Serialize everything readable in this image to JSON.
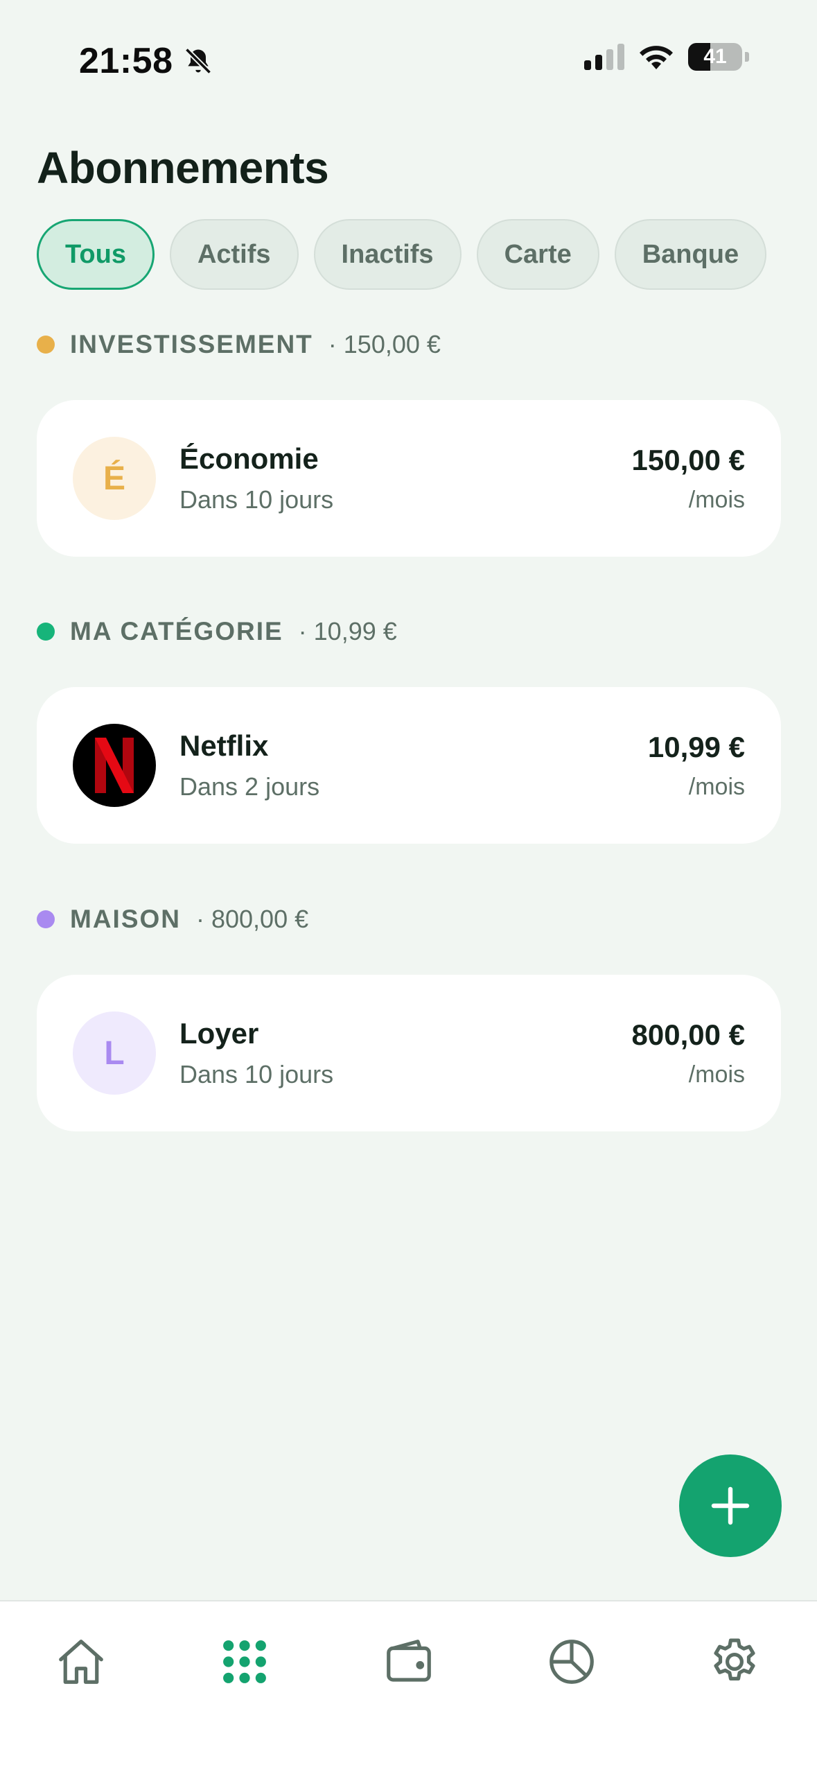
{
  "status_bar": {
    "time": "21:58",
    "battery_level": "41"
  },
  "page": {
    "title": "Abonnements"
  },
  "filters": [
    {
      "label": "Tous",
      "active": true
    },
    {
      "label": "Actifs",
      "active": false
    },
    {
      "label": "Inactifs",
      "active": false
    },
    {
      "label": "Carte",
      "active": false
    },
    {
      "label": "Banque",
      "active": false
    }
  ],
  "sections": [
    {
      "name": "INVESTISSEMENT",
      "total": "· 150,00 €",
      "color": "#e8b04a",
      "items": [
        {
          "initial": "É",
          "name": "Économie",
          "due": "Dans 10 jours",
          "amount": "150,00 €",
          "period": "/mois",
          "avatar_bg": "#fcf1e0",
          "avatar_fg": "#e8b04a"
        }
      ]
    },
    {
      "name": "MA CATÉGORIE",
      "total": "· 10,99 €",
      "color": "#17b47a",
      "items": [
        {
          "initial": "N",
          "name": "Netflix",
          "due": "Dans 2 jours",
          "amount": "10,99 €",
          "period": "/mois",
          "avatar_bg": "#000000",
          "avatar_fg": "#e50914"
        }
      ]
    },
    {
      "name": "MAISON",
      "total": "· 800,00 €",
      "color": "#a98af0",
      "items": [
        {
          "initial": "L",
          "name": "Loyer",
          "due": "Dans 10 jours",
          "amount": "800,00 €",
          "period": "/mois",
          "avatar_bg": "#efeafd",
          "avatar_fg": "#a98af0"
        }
      ]
    }
  ],
  "tab_bar": {
    "items": [
      {
        "icon": "home-icon",
        "active": false
      },
      {
        "icon": "grid-icon",
        "active": true
      },
      {
        "icon": "wallet-icon",
        "active": false
      },
      {
        "icon": "pie-chart-icon",
        "active": false
      },
      {
        "icon": "gear-icon",
        "active": false
      }
    ]
  },
  "fab": {
    "icon": "plus-icon"
  },
  "colors": {
    "accent": "#14a36f",
    "background": "#f1f6f2"
  }
}
